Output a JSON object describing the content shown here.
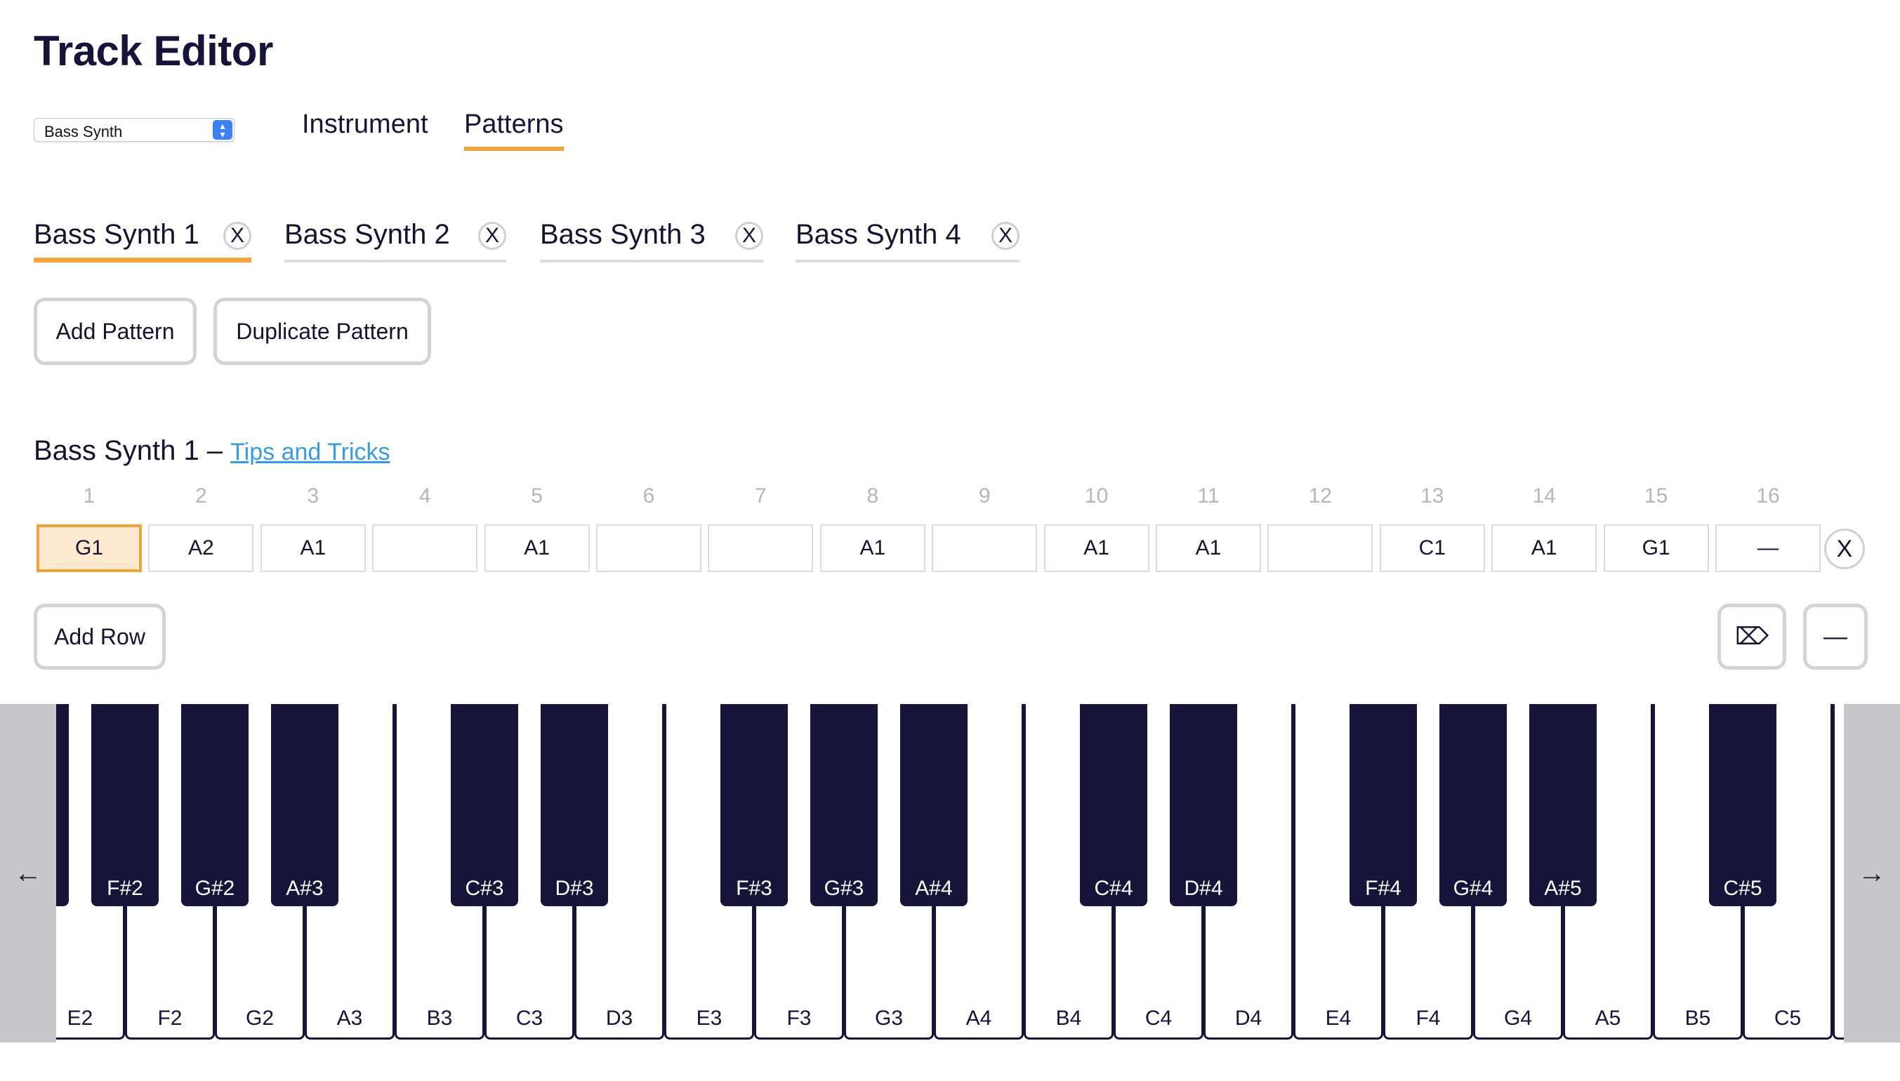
{
  "page_title": "Track Editor",
  "instrument_select": {
    "value": "Bass Synth"
  },
  "main_tabs": [
    {
      "label": "Instrument",
      "active": false
    },
    {
      "label": "Patterns",
      "active": true
    }
  ],
  "pattern_tabs": [
    {
      "label": "Bass Synth 1",
      "close": "X",
      "active": true
    },
    {
      "label": "Bass Synth 2",
      "close": "X",
      "active": false
    },
    {
      "label": "Bass Synth 3",
      "close": "X",
      "active": false
    },
    {
      "label": "Bass Synth 4",
      "close": "X",
      "active": false
    }
  ],
  "buttons": {
    "add_pattern": "Add Pattern",
    "duplicate_pattern": "Duplicate Pattern",
    "add_row": "Add Row",
    "clear_icon": "⌦",
    "rest_icon": "—"
  },
  "section": {
    "title": "Bass Synth 1 –",
    "link": "Tips and Tricks"
  },
  "steps": {
    "numbers": [
      "1",
      "2",
      "3",
      "4",
      "5",
      "6",
      "7",
      "8",
      "9",
      "10",
      "11",
      "12",
      "13",
      "14",
      "15",
      "16"
    ],
    "row": [
      "G1",
      "A2",
      "A1",
      "",
      "A1",
      "",
      "",
      "A1",
      "",
      "A1",
      "A1",
      "",
      "C1",
      "A1",
      "G1",
      "—"
    ],
    "selected_index": 0,
    "row_close": "X"
  },
  "piano": {
    "nav_left": "←",
    "nav_right": "→",
    "white_keys": [
      "E2",
      "F2",
      "G2",
      "A3",
      "B3",
      "C3",
      "D3",
      "E3",
      "F3",
      "G3",
      "A4",
      "B4",
      "C4",
      "D4",
      "E4",
      "F4",
      "G4",
      "A5",
      "B5",
      "C5"
    ],
    "black_keys": [
      "F#2",
      "G#2",
      "A#3",
      "C#3",
      "D#3",
      "F#3",
      "G#3",
      "A#4",
      "C#4",
      "D#4",
      "F#4",
      "G#4",
      "A#5",
      "C#5"
    ]
  },
  "colors": {
    "accent": "#f2a33a",
    "ink": "#17143a",
    "link": "#3b9be0"
  }
}
